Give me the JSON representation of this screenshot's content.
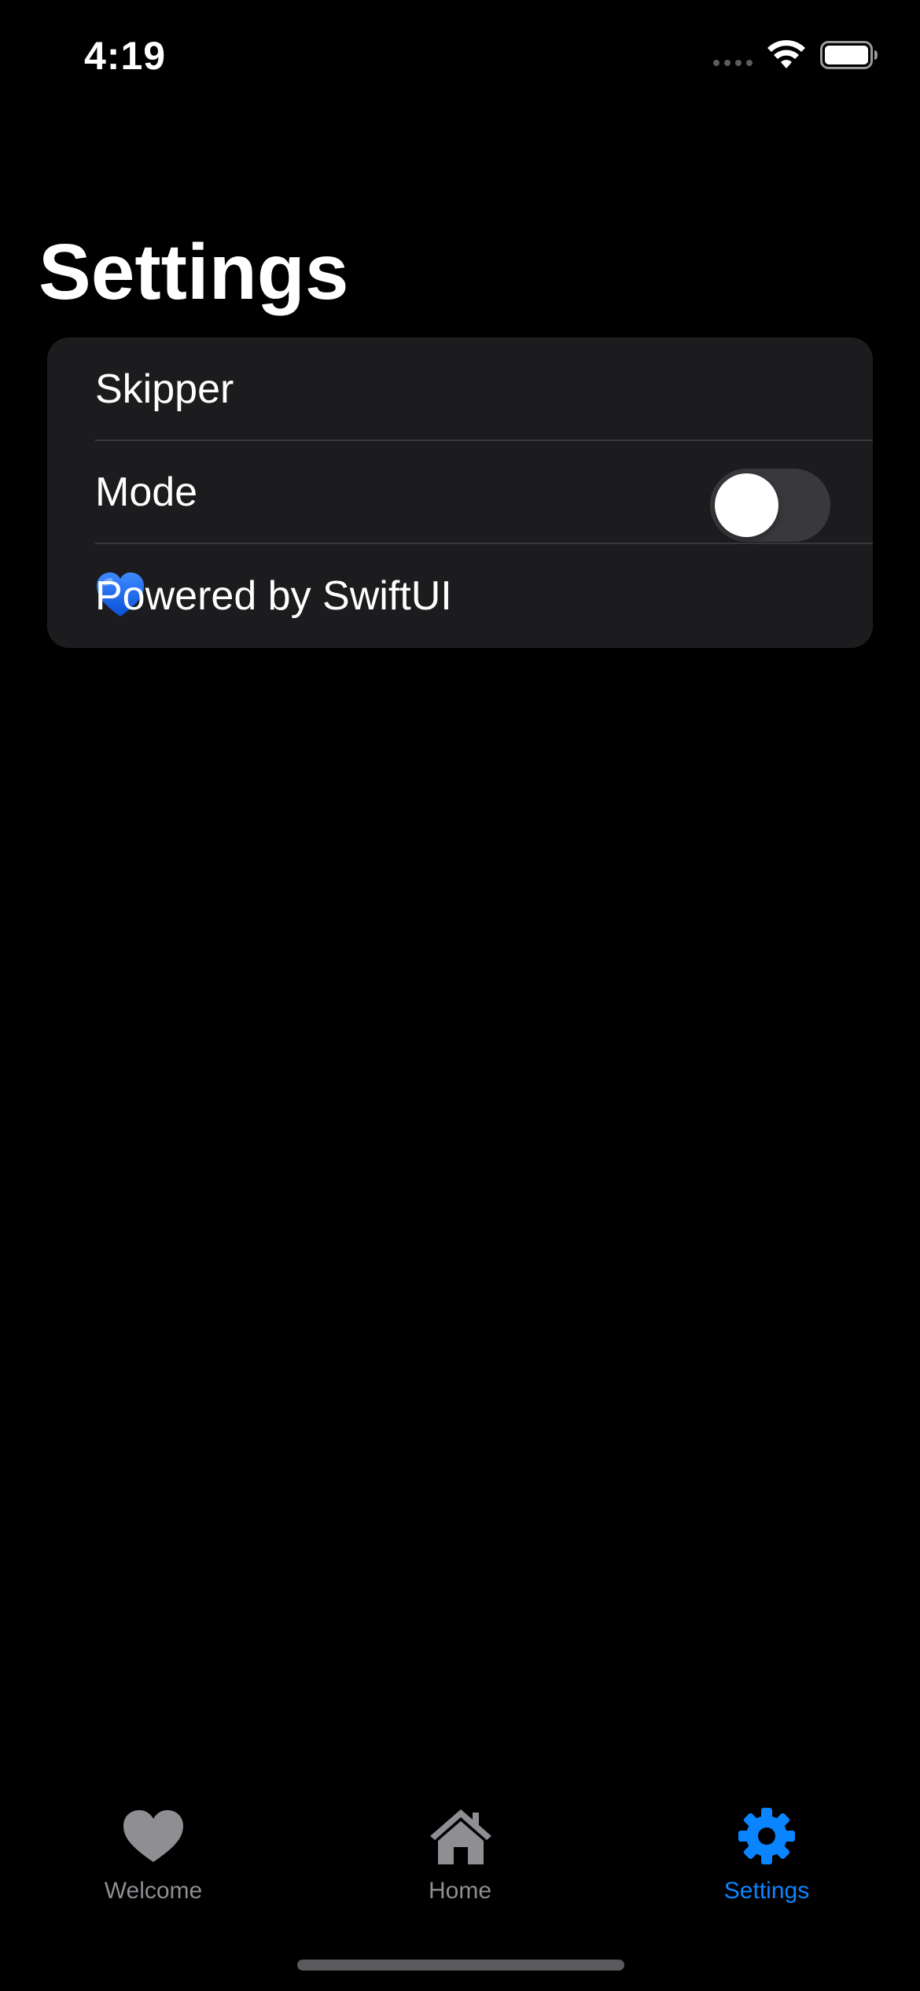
{
  "status_bar": {
    "time": "4:19"
  },
  "page": {
    "title": "Settings"
  },
  "settings_list": {
    "rows": [
      {
        "label": "Skipper"
      },
      {
        "label": "Mode",
        "toggle_on": false
      },
      {
        "label": "Powered by SwiftUI",
        "icon": "blue-heart-icon"
      }
    ]
  },
  "tab_bar": {
    "active_color": "#0a84ff",
    "inactive_color": "#8e8e93",
    "tabs": [
      {
        "label": "Welcome",
        "icon": "heart-icon",
        "selected": false
      },
      {
        "label": "Home",
        "icon": "house-icon",
        "selected": false
      },
      {
        "label": "Settings",
        "icon": "gear-icon",
        "selected": true
      }
    ]
  }
}
